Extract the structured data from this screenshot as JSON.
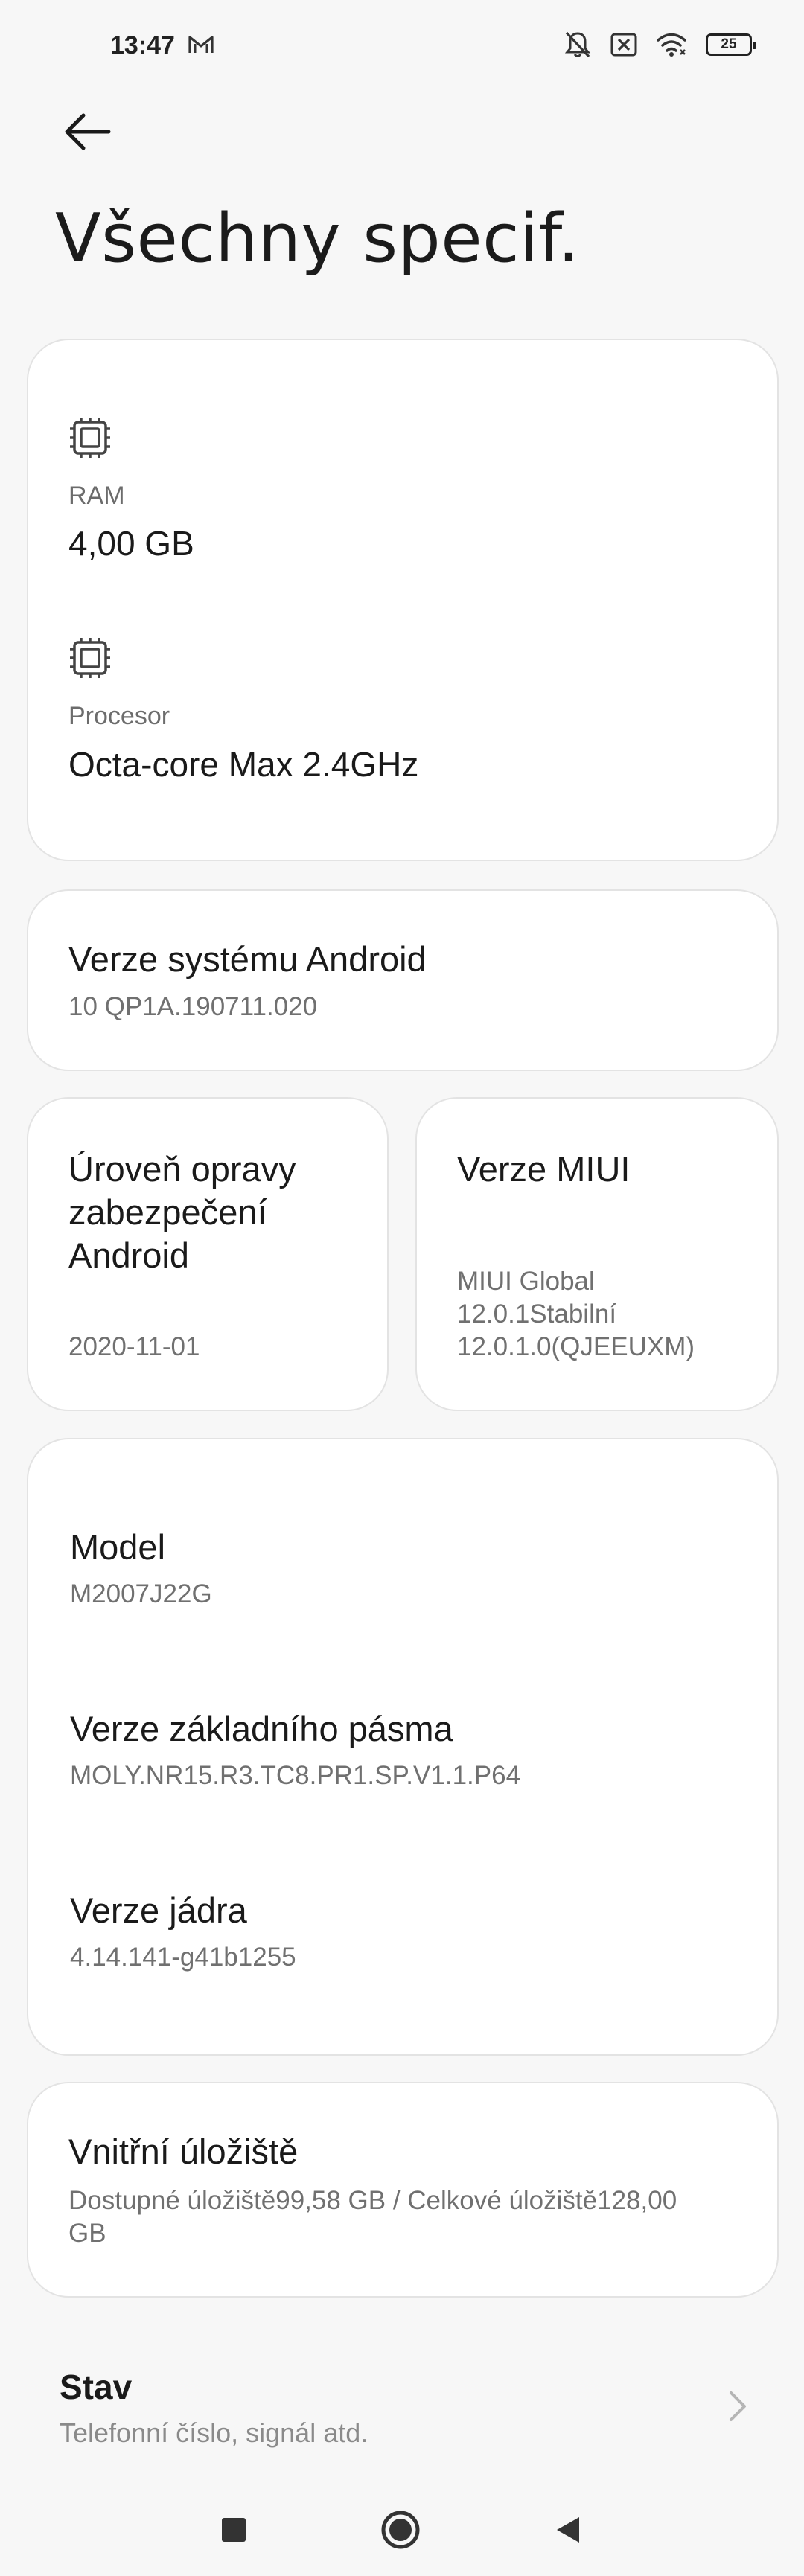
{
  "status_bar": {
    "time": "13:47",
    "battery": "25",
    "icons": [
      "mail-icon",
      "mute-icon",
      "sim-error-icon",
      "wifi-icon",
      "battery-icon"
    ]
  },
  "header": {
    "title": "Všechny specif."
  },
  "card_hardware": {
    "ram_label": "RAM",
    "ram_value": "4,00 GB",
    "cpu_label": "Procesor",
    "cpu_value": "Octa-core Max 2.4GHz"
  },
  "card_android": {
    "title": "Verze systému Android",
    "value": "10 QP1A.190711.020"
  },
  "card_security": {
    "title_line1": "Úroveň opravy",
    "title_line2": "zabezpečení",
    "title_line3": "Android",
    "value": "2020-11-01"
  },
  "card_miui": {
    "title": "Verze MIUI",
    "value_line1": "MIUI Global",
    "value_line2": "12.0.1Stabilní",
    "value_line3": "12.0.1.0(QJEEUXM)"
  },
  "card_device": {
    "model_title": "Model",
    "model_value": "M2007J22G",
    "baseband_title": "Verze základního pásma",
    "baseband_value": "MOLY.NR15.R3.TC8.PR1.SP.V1.1.P64",
    "kernel_title": "Verze jádra",
    "kernel_value": "4.14.141-g41b1255"
  },
  "card_storage": {
    "title": "Vnitřní úložiště",
    "value_line1": "Dostupné úložiště99,58 GB / Celkové úložiště128,00",
    "value_line2": "GB"
  },
  "status_item": {
    "title": "Stav",
    "subtitle": "Telefonní číslo, signál atd."
  }
}
